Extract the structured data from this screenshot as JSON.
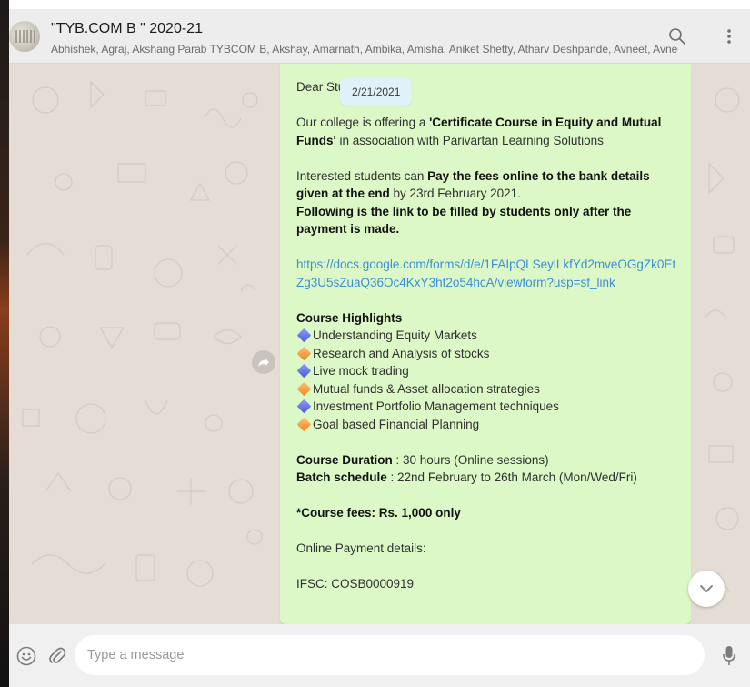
{
  "header": {
    "title": "\"TYB.COM B \" 2020-21",
    "members": "Abhishek, Agraj, Akshang Parab TYBCOM B, Akshay, Amarnath, Ambika, Amisha, Aniket Shetty, Atharv Deshpande, Avneet, Avneet, Bas...",
    "search_icon": "search-icon",
    "menu_icon": "menu-dots-icon"
  },
  "message": {
    "greeting": "Dear Stude",
    "date": "2/21/2021",
    "intro_before": "Our college is offering a ",
    "intro_bold": "'Certificate Course in Equity and Mutual Funds'",
    "intro_after": " in association with Parivartan Learning Solutions",
    "interest_before": "Interested students can ",
    "interest_bold": "Pay the fees online to the bank details given at the end",
    "interest_after": " by 23rd February 2021.",
    "link_note": "Following is the link to be filled by students only after the payment is made.",
    "link": "https://docs.google.com/forms/d/e/1FAIpQLSeylLkfYd2mveOGgZk0EtZg3U5sZuaQ36Oc4KxY3ht2o54hcA/viewform?usp=sf_link",
    "highlights_title": "Course Highlights",
    "highlights": [
      {
        "text": "Understanding Equity Markets",
        "marker": "blue-diamond-icon"
      },
      {
        "text": "Research and Analysis of stocks",
        "marker": "orange-diamond-icon"
      },
      {
        "text": "Live mock trading",
        "marker": "blue-diamond-icon"
      },
      {
        "text": "Mutual funds & Asset allocation strategies",
        "marker": "orange-diamond-icon"
      },
      {
        "text": "Investment Portfolio Management techniques",
        "marker": "blue-diamond-icon"
      },
      {
        "text": "Goal based Financial Planning",
        "marker": "orange-diamond-icon"
      }
    ],
    "duration_label": "Course Duration",
    "duration_value": " : 30 hours (Online sessions)",
    "batch_label": "Batch schedule",
    "batch_value": " : 22nd February to 26th March (Mon/Wed/Fri)",
    "fees": "*Course fees:  Rs. 1,000 only",
    "payment_label": "Online Payment details:",
    "ifsc": "IFSC: COSB0000919"
  },
  "footer": {
    "placeholder": "Type a message",
    "emoji_icon": "emoji-icon",
    "attach_icon": "paperclip-icon",
    "mic_icon": "microphone-icon"
  },
  "colors": {
    "header_bg": "#ededed",
    "chat_bg": "#e5ddd5",
    "bubble_bg": "#dcf8c6",
    "date_chip_bg": "#e1f1fa",
    "link": "#3a8fd6",
    "footer_bg": "#f0f0f0"
  }
}
